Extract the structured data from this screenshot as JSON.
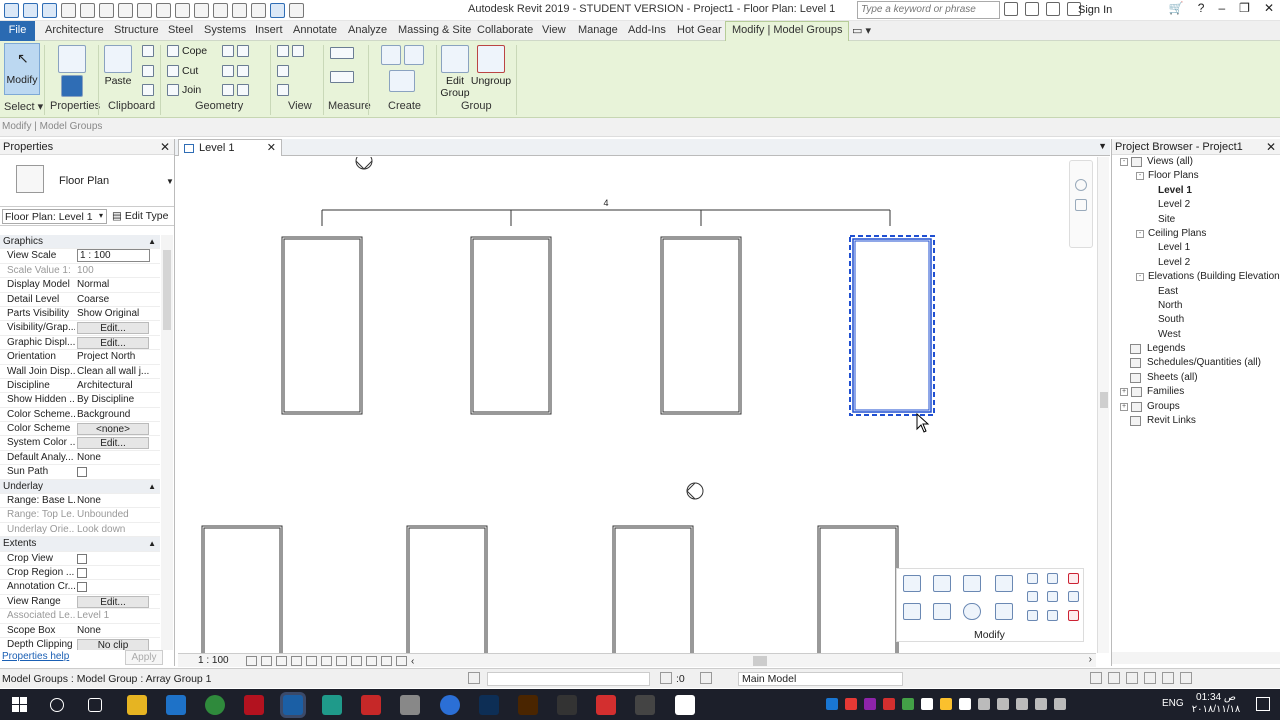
{
  "titlebar": {
    "title": "Autodesk Revit 2019 - STUDENT VERSION -  Project1 - Floor Plan: Level 1",
    "search_placeholder": "Type a keyword or phrase",
    "sign_in": "Sign In"
  },
  "tabs": [
    "File",
    "Architecture",
    "Structure",
    "Steel",
    "Systems",
    "Insert",
    "Annotate",
    "Analyze",
    "Massing & Site",
    "Collaborate",
    "View",
    "Manage",
    "Add-Ins",
    "Hot Gear",
    "Modify | Model Groups"
  ],
  "ribbon": {
    "modify": "Modify",
    "paste": "Paste",
    "cope": "Cope",
    "cut": "Cut",
    "join": "Join",
    "edit_group": "Edit Group",
    "ungroup": "Ungroup",
    "panels": {
      "select": "Select",
      "properties": "Properties",
      "clipboard": "Clipboard",
      "geometry": "Geometry",
      "view": "View",
      "measure": "Measure",
      "create": "Create",
      "group": "Group"
    }
  },
  "options_bar": "Modify | Model Groups",
  "properties": {
    "title": "Properties",
    "type_name": "Floor Plan",
    "instance": "Floor Plan: Level 1",
    "edit_type": "Edit Type",
    "rows": [
      {
        "k": "Graphics",
        "sec": true
      },
      {
        "k": "View Scale",
        "v": "1 : 100",
        "input": true
      },
      {
        "k": "Scale Value    1:",
        "v": "100",
        "gray": true
      },
      {
        "k": "Display Model",
        "v": "Normal"
      },
      {
        "k": "Detail Level",
        "v": "Coarse"
      },
      {
        "k": "Parts Visibility",
        "v": "Show Original"
      },
      {
        "k": "Visibility/Grap...",
        "v": "Edit...",
        "btn": true
      },
      {
        "k": "Graphic Displ...",
        "v": "Edit...",
        "btn": true
      },
      {
        "k": "Orientation",
        "v": "Project North"
      },
      {
        "k": "Wall Join Disp...",
        "v": "Clean all wall j..."
      },
      {
        "k": "Discipline",
        "v": "Architectural"
      },
      {
        "k": "Show Hidden ...",
        "v": "By Discipline"
      },
      {
        "k": "Color Scheme...",
        "v": "Background"
      },
      {
        "k": "Color Scheme",
        "v": "<none>",
        "btn": true
      },
      {
        "k": "System Color ...",
        "v": "Edit...",
        "btn": true
      },
      {
        "k": "Default Analy...",
        "v": "None"
      },
      {
        "k": "Sun Path",
        "v": "",
        "check": true
      },
      {
        "k": "Underlay",
        "sec": true
      },
      {
        "k": "Range: Base L...",
        "v": "None"
      },
      {
        "k": "Range: Top Le...",
        "v": "Unbounded",
        "gray": true
      },
      {
        "k": "Underlay Orie...",
        "v": "Look down",
        "gray": true
      },
      {
        "k": "Extents",
        "sec": true
      },
      {
        "k": "Crop View",
        "v": "",
        "check": true
      },
      {
        "k": "Crop Region ...",
        "v": "",
        "check": true
      },
      {
        "k": "Annotation Cr...",
        "v": "",
        "check": true
      },
      {
        "k": "View Range",
        "v": "Edit...",
        "btn": true
      },
      {
        "k": "Associated Le...",
        "v": "Level 1",
        "gray": true
      },
      {
        "k": "Scope Box",
        "v": "None"
      },
      {
        "k": "Depth Clipping",
        "v": "No clip",
        "btn": true
      }
    ],
    "help": "Properties help",
    "apply": "Apply"
  },
  "view": {
    "tab": "Level 1",
    "dim_label": "4",
    "scale": "1 : 100"
  },
  "tools": {
    "label": "Modify"
  },
  "browser": {
    "title": "Project Browser - Project1",
    "nodes": [
      {
        "label": "Views (all)",
        "indent": 0,
        "toggle": "-",
        "icon": true
      },
      {
        "label": "Floor Plans",
        "indent": 1,
        "toggle": "-"
      },
      {
        "label": "Level 1",
        "indent": 2,
        "bold": true
      },
      {
        "label": "Level 2",
        "indent": 2
      },
      {
        "label": "Site",
        "indent": 2
      },
      {
        "label": "Ceiling Plans",
        "indent": 1,
        "toggle": "-"
      },
      {
        "label": "Level 1",
        "indent": 2
      },
      {
        "label": "Level 2",
        "indent": 2
      },
      {
        "label": "Elevations (Building Elevation)",
        "indent": 1,
        "toggle": "-"
      },
      {
        "label": "East",
        "indent": 2
      },
      {
        "label": "North",
        "indent": 2
      },
      {
        "label": "South",
        "indent": 2
      },
      {
        "label": "West",
        "indent": 2
      },
      {
        "label": "Legends",
        "indent": 0,
        "icon": true
      },
      {
        "label": "Schedules/Quantities (all)",
        "indent": 0,
        "icon": true
      },
      {
        "label": "Sheets (all)",
        "indent": 0,
        "icon": true
      },
      {
        "label": "Families",
        "indent": 0,
        "toggle": "+",
        "icon": true
      },
      {
        "label": "Groups",
        "indent": 0,
        "toggle": "+",
        "icon": true
      },
      {
        "label": "Revit Links",
        "indent": 0,
        "icon": true
      }
    ]
  },
  "status": {
    "message": "Model Groups : Model Group : Array Group 1",
    "zero": ":0",
    "model": "Main Model"
  },
  "taskbar": {
    "lang": "ENG",
    "time": "01:34 ص",
    "date": "٢٠١٨/١١/١٨"
  },
  "colors": {
    "ribbon_bg": "#e8f3d9",
    "file_tab": "#2a6ab2",
    "selection": "#1f4fd1",
    "taskbar": "#1c1f2a"
  }
}
